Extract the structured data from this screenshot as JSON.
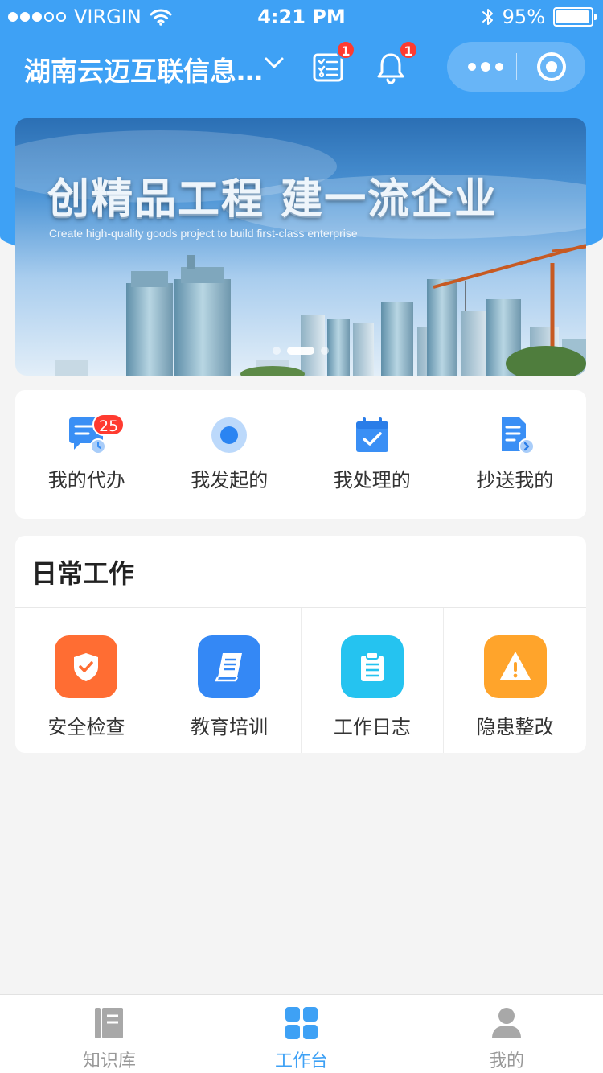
{
  "status_bar": {
    "carrier": "VIRGIN",
    "time": "4:21 PM",
    "battery": "95%",
    "battery_level": 0.95
  },
  "nav": {
    "org_name": "湖南云迈互联信息...",
    "todo_badge": "1",
    "bell_badge": "1"
  },
  "banner": {
    "headline": "创精品工程  建一流企业",
    "subline": "Create high-quality goods project to build first-class enterprise",
    "slides": 3,
    "active_slide": 1
  },
  "quick_actions": [
    {
      "label": "我的代办",
      "icon": "chat-clock-icon",
      "badge": "25"
    },
    {
      "label": "我发起的",
      "icon": "target-dot-icon"
    },
    {
      "label": "我处理的",
      "icon": "calendar-check-icon"
    },
    {
      "label": "抄送我的",
      "icon": "document-forward-icon"
    }
  ],
  "daily_work": {
    "title": "日常工作",
    "items": [
      {
        "label": "安全检查",
        "icon": "shield-check-icon",
        "color": "#ff6d33"
      },
      {
        "label": "教育培训",
        "icon": "book-icon",
        "color": "#3488f5"
      },
      {
        "label": "工作日志",
        "icon": "clipboard-icon",
        "color": "#25c3f0"
      },
      {
        "label": "隐患整改",
        "icon": "warning-icon",
        "color": "#ffa42b"
      }
    ]
  },
  "tab_bar": {
    "tabs": [
      {
        "label": "知识库",
        "icon": "notebook-icon"
      },
      {
        "label": "工作台",
        "icon": "grid-icon",
        "active": true
      },
      {
        "label": "我的",
        "icon": "user-icon"
      }
    ]
  },
  "colors": {
    "primary": "#3ea1f5",
    "badge": "#ff3b30",
    "background": "#f4f4f4"
  }
}
